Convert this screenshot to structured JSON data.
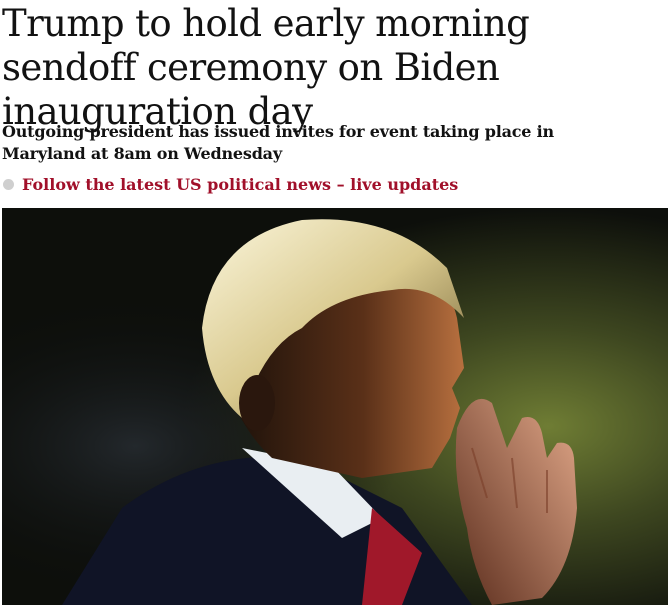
{
  "article": {
    "headline": "Trump to hold early morning sendoff ceremony on Biden inauguration day",
    "standfirst": "Outgoing president has issued invites for event taking place in Maryland at 8am on Wednesday",
    "live_link": "Follow the latest US political news – live updates"
  },
  "colors": {
    "link": "#a1102a",
    "bullet": "#cfcfcf",
    "text": "#121212"
  }
}
